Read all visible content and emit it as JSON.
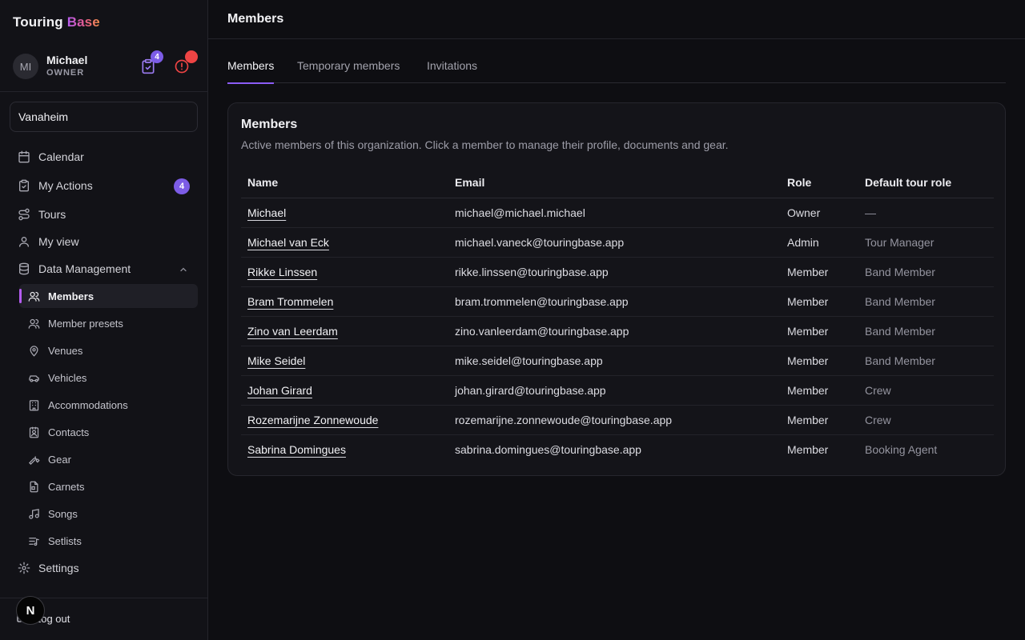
{
  "brand": {
    "part1": "Touring",
    "part2": "Base"
  },
  "user": {
    "initials": "MI",
    "name": "Michael",
    "role": "OWNER",
    "tasks_count": "4"
  },
  "org": {
    "selected": "Vanaheim"
  },
  "nav": {
    "calendar": "Calendar",
    "my_actions": "My Actions",
    "my_actions_count": "4",
    "tours": "Tours",
    "my_view": "My view",
    "data_management": "Data Management",
    "settings": "Settings"
  },
  "data_management_items": {
    "members": "Members",
    "member_presets": "Member presets",
    "venues": "Venues",
    "vehicles": "Vehicles",
    "accommodations": "Accommodations",
    "contacts": "Contacts",
    "gear": "Gear",
    "carnets": "Carnets",
    "songs": "Songs",
    "setlists": "Setlists"
  },
  "footer": {
    "logout": "Log out",
    "n_button": "N"
  },
  "page": {
    "title": "Members"
  },
  "tabs": {
    "members": "Members",
    "temporary": "Temporary members",
    "invitations": "Invitations"
  },
  "card": {
    "title": "Members",
    "description": "Active members of this organization. Click a member to manage their profile, documents and gear."
  },
  "table": {
    "headers": {
      "name": "Name",
      "email": "Email",
      "role": "Role",
      "tour_role": "Default tour role"
    },
    "rows": [
      {
        "name": "Michael",
        "email": "michael@michael.michael",
        "role": "Owner",
        "tour_role": "—"
      },
      {
        "name": "Michael van Eck",
        "email": "michael.vaneck@touringbase.app",
        "role": "Admin",
        "tour_role": "Tour Manager"
      },
      {
        "name": "Rikke Linssen",
        "email": "rikke.linssen@touringbase.app",
        "role": "Member",
        "tour_role": "Band Member"
      },
      {
        "name": "Bram Trommelen",
        "email": "bram.trommelen@touringbase.app",
        "role": "Member",
        "tour_role": "Band Member"
      },
      {
        "name": "Zino van Leerdam",
        "email": "zino.vanleerdam@touringbase.app",
        "role": "Member",
        "tour_role": "Band Member"
      },
      {
        "name": "Mike Seidel",
        "email": "mike.seidel@touringbase.app",
        "role": "Member",
        "tour_role": "Band Member"
      },
      {
        "name": "Johan Girard",
        "email": "johan.girard@touringbase.app",
        "role": "Member",
        "tour_role": "Crew"
      },
      {
        "name": "Rozemarijne Zonnewoude",
        "email": "rozemarijne.zonnewoude@touringbase.app",
        "role": "Member",
        "tour_role": "Crew"
      },
      {
        "name": "Sabrina Domingues",
        "email": "sabrina.domingues@touringbase.app",
        "role": "Member",
        "tour_role": "Booking Agent"
      }
    ]
  },
  "colors": {
    "accent": "#8b5cf6",
    "alert": "#ef4444",
    "background": "#0e0e12"
  }
}
